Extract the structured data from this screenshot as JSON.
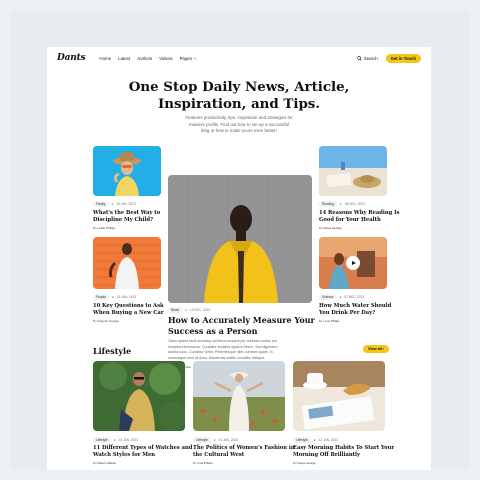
{
  "nav": {
    "logo": "Dants",
    "links": [
      "Home",
      "Latest",
      "Authors",
      "Videos",
      "Pages"
    ],
    "search_label": "Search",
    "cta_label": "Get in Touch"
  },
  "hero": {
    "title_line1": "One Stop Daily News, Article,",
    "title_line2": "Inspiration, and Tips.",
    "subtitle_line1": "Features productivity, tips, inspiration and strategies for",
    "subtitle_line2": "massive profits. Find out how to set up a successful",
    "subtitle_line3": "blog or how to make yours even better!"
  },
  "featured": {
    "left_top": {
      "tag": "Family",
      "date": "16 JAN, 2023",
      "title_line1": "What's the Best Way to",
      "title_line2": "Discipline My Child?",
      "by": "By",
      "author": "Leslie Philips"
    },
    "left_bottom": {
      "tag": "People",
      "date": "15 JAN, 2023",
      "title_line1": "10 Key Questions to Ask",
      "title_line2": "When Buying a New Car",
      "by": "By",
      "author": "Kaylynn George"
    },
    "center": {
      "tag": "News",
      "date": "10 DEC, 2023",
      "title_line1": "How to Accurately Measure Your",
      "title_line2": "Success as a Person",
      "excerpt_line1": "Class aptent taciti sociosqu ad litora torquent per conubia nostra, per",
      "excerpt_line2": "inceptos himenaeos. Curabitur sodales ligula in libero. Sed dignissim",
      "excerpt_line3": "lacinia nunc. Curabitur tortor. Pellentesque nibh. Aenean quam. In",
      "excerpt_line4": "scelerisque sem at dolor. Maecenas mattis convallis tristique.",
      "by": "By",
      "author": "Justin Gordon"
    },
    "right_top": {
      "tag": "Reading",
      "date": "08 DEC, 2023",
      "title_line1": "14 Reasons Why Reading Is",
      "title_line2": "Good for Your Health",
      "by": "By",
      "author": "Kaiya George"
    },
    "right_bottom": {
      "tag": "Science",
      "date": "07 DEC, 2023",
      "title_line1": "How Much Water Should",
      "title_line2": "You Drink Per Day?",
      "by": "By",
      "author": "Leos Philips"
    }
  },
  "lifestyle": {
    "title": "Lifestyle",
    "view_all": "View all",
    "cards": [
      {
        "tag": "Lifestyle",
        "date": "15 JAN, 2023",
        "title_line1": "11 Different Types of Watches and",
        "title_line2": "Watch Styles for Men",
        "by": "By",
        "author": "Mason Mason"
      },
      {
        "tag": "Lifestyle",
        "date": "14 JAN, 2023",
        "title_line1": "The Politics of Women's Fashion in",
        "title_line2": "the Cultural West",
        "by": "By",
        "author": "Lina Philips"
      },
      {
        "tag": "Lifestyle",
        "date": "12 JAN, 2023",
        "title_line1": "Easy Morning Habits To Start Your",
        "title_line2": "Morning Off Brilliantly",
        "by": "By",
        "author": "Kaiya George"
      }
    ]
  },
  "colors": {
    "accent": "#f5c518",
    "background": "#eceff3",
    "card_bg": "#ffffff"
  }
}
